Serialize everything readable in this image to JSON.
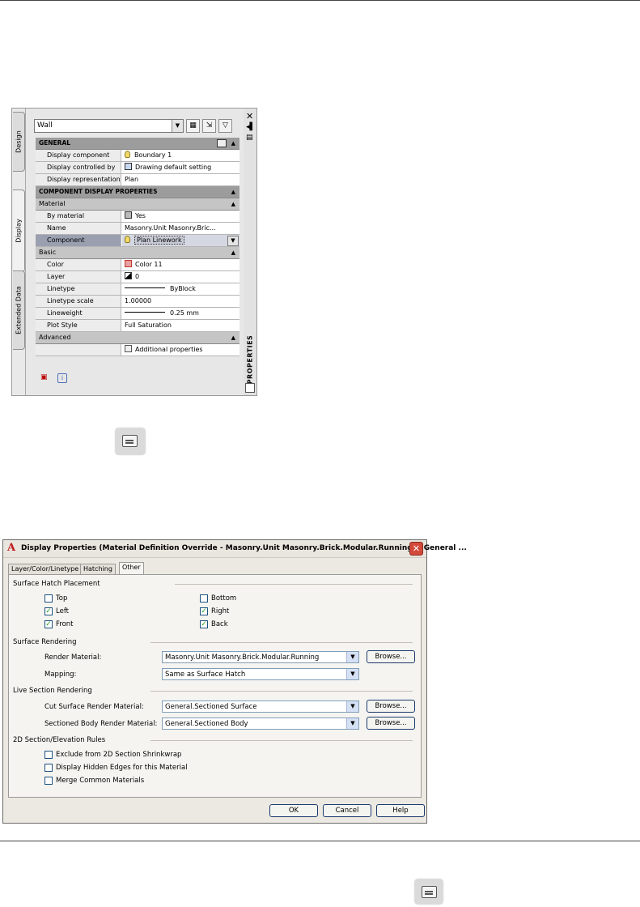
{
  "palette": {
    "side_tabs": [
      "Design",
      "Display",
      "Extended Data"
    ],
    "title": "PROPERTIES",
    "object_selector": "Wall",
    "general": {
      "header": "GENERAL",
      "rows": [
        {
          "label": "Display component",
          "value": "Boundary 1"
        },
        {
          "label": "Display controlled by",
          "value": "Drawing default setting"
        },
        {
          "label": "Display representation",
          "value": "Plan"
        }
      ]
    },
    "component_display": {
      "header": "COMPONENT DISPLAY PROPERTIES",
      "material": {
        "header": "Material",
        "rows": [
          {
            "label": "By material",
            "value": "Yes"
          },
          {
            "label": "Name",
            "value": "Masonry.Unit Masonry.Bric..."
          },
          {
            "label": "Component",
            "value": "Plan Linework"
          }
        ]
      },
      "basic": {
        "header": "Basic",
        "rows": [
          {
            "label": "Color",
            "value": "Color 11"
          },
          {
            "label": "Layer",
            "value": "0"
          },
          {
            "label": "Linetype",
            "value": "ByBlock"
          },
          {
            "label": "Linetype scale",
            "value": "1.00000"
          },
          {
            "label": "Lineweight",
            "value": "0.25 mm"
          },
          {
            "label": "Plot Style",
            "value": "Full Saturation"
          }
        ]
      },
      "advanced": {
        "header": "Advanced",
        "value": "Additional properties"
      }
    }
  },
  "dialog": {
    "title": "Display Properties (Material Definition Override - Masonry.Unit Masonry.Brick.Modular.Running) - General ...",
    "tabs": [
      "Layer/Color/Linetype",
      "Hatching",
      "Other"
    ],
    "surface_hatch": {
      "label": "Surface Hatch Placement",
      "options": [
        {
          "label": "Top",
          "checked": false
        },
        {
          "label": "Bottom",
          "checked": false
        },
        {
          "label": "Left",
          "checked": true
        },
        {
          "label": "Right",
          "checked": true
        },
        {
          "label": "Front",
          "checked": true
        },
        {
          "label": "Back",
          "checked": true
        }
      ]
    },
    "surface_rendering": {
      "label": "Surface Rendering",
      "render_material_label": "Render Material:",
      "render_material_value": "Masonry.Unit Masonry.Brick.Modular.Running",
      "mapping_label": "Mapping:",
      "mapping_value": "Same as Surface Hatch"
    },
    "live_section": {
      "label": "Live Section Rendering",
      "cut_surface_label": "Cut Surface Render Material:",
      "cut_surface_value": "General.Sectioned Surface",
      "sectioned_body_label": "Sectioned Body Render Material:",
      "sectioned_body_value": "General.Sectioned Body"
    },
    "section_rules": {
      "label": "2D Section/Elevation Rules",
      "options": [
        {
          "label": "Exclude from 2D Section Shrinkwrap",
          "checked": false
        },
        {
          "label": "Display Hidden Edges for this Material",
          "checked": false
        },
        {
          "label": "Merge Common Materials",
          "checked": false
        }
      ]
    },
    "browse_label": "Browse...",
    "ok_label": "OK",
    "cancel_label": "Cancel",
    "help_label": "Help"
  },
  "colors": {
    "accent_check": "#21a121",
    "close_red": "#d44a3a",
    "color11_swatch": "#e8a0a0"
  },
  "icons": [
    "close-icon",
    "auto-hide-icon",
    "properties-menu-icon",
    "select-objects-icon",
    "quick-select-icon",
    "toggle-pickadd-icon",
    "bulb-icon",
    "additional-properties-icon"
  ]
}
